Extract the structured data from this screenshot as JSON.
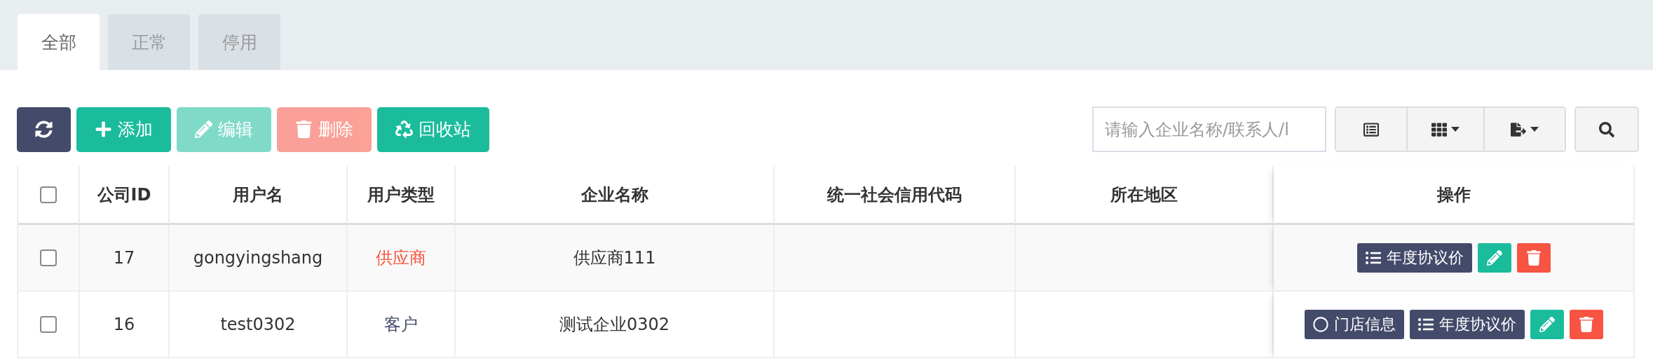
{
  "tabs": [
    {
      "label": "全部",
      "selected": true
    },
    {
      "label": "正常",
      "selected": false
    },
    {
      "label": "停用",
      "selected": false
    }
  ],
  "toolbar": [
    {
      "kind": "refresh",
      "disabled": false
    },
    {
      "kind": "add",
      "label": "添加",
      "disabled": false
    },
    {
      "kind": "edit",
      "label": "编辑",
      "disabled": true
    },
    {
      "kind": "delete",
      "label": "删除",
      "disabled": true
    },
    {
      "kind": "recycle",
      "label": "回收站",
      "disabled": false
    }
  ],
  "search": {
    "placeholder": "请输入企业名称/联系人/l"
  },
  "table": {
    "select_all": {
      "checked": false
    },
    "columns": [
      "公司ID",
      "用户名",
      "用户类型",
      "企业名称",
      "统一社会信用代码",
      "所在地区",
      "操作"
    ],
    "rows": [
      {
        "checked": false,
        "id": "17",
        "username": "gongyingshang",
        "user_type": {
          "text": "供应商",
          "color": "#f5533d"
        },
        "company": "供应商111",
        "actions": [
          {
            "kind": "price",
            "label": "年度协议价"
          },
          {
            "kind": "edit"
          },
          {
            "kind": "delete"
          }
        ]
      },
      {
        "checked": false,
        "id": "16",
        "username": "test0302",
        "user_type": {
          "text": "客户",
          "color": "#444a6a"
        },
        "company": "测试企业0302",
        "actions": [
          {
            "kind": "store",
            "label": "门店信息"
          },
          {
            "kind": "price",
            "label": "年度协议价"
          },
          {
            "kind": "edit"
          },
          {
            "kind": "delete"
          }
        ]
      }
    ]
  }
}
